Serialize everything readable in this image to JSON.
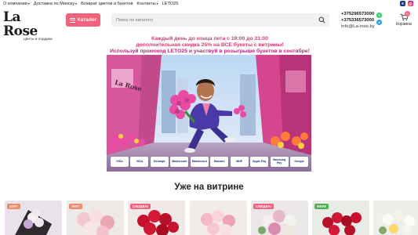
{
  "topnav": {
    "items": [
      {
        "label": "О компании",
        "dropdown": true
      },
      {
        "label": "Доставка по Минску",
        "dropdown": true
      },
      {
        "label": "Возврат цветов и букетов",
        "dropdown": false
      },
      {
        "label": "Контакты",
        "dropdown": true
      },
      {
        "label": "LETO25",
        "dropdown": false
      }
    ],
    "social": [
      "vk-icon",
      "instagram-icon"
    ]
  },
  "header": {
    "logo_text": "La Rose",
    "logo_subtitle": "цветы и подарки",
    "catalog_label": "Каталог",
    "search_placeholder": "Поиск по каталогу",
    "phone1": "+375296573000",
    "phone2": "+375336573000",
    "email": "info@La-rose.by",
    "cart_label": "Корзина",
    "cart_count": "0"
  },
  "promo": {
    "line1": "Каждый день до конца лета с 19:00 до 21:00",
    "line2": "дополнительная скидка 25% на ВСЕ букеты с витрины!",
    "line3": "Используй промокод LETO25 и участвуй в розыгрыше букетов в сентябре!"
  },
  "banner": {
    "storefront_sign": "La Rose",
    "payments": [
      "VISA",
      "VISA",
      "Белкарт",
      "Mastercard",
      "Mastercard",
      "Maestro",
      "МИР",
      "Apple Pay",
      "Samsung Pay",
      "Google"
    ]
  },
  "section": {
    "title": "Уже на витрине"
  },
  "products": [
    {
      "badge": "ХИТ!",
      "badge_type": "hit"
    },
    {
      "badge": "ХИТ!",
      "badge_type": "hit"
    },
    {
      "badge": "СКИДКА!",
      "badge_type": "sale"
    },
    {
      "badge": "",
      "badge_type": ""
    },
    {
      "badge": "СКИДКА!",
      "badge_type": "sale"
    },
    {
      "badge": "NEW!",
      "badge_type": "new"
    },
    {
      "badge": "",
      "badge_type": ""
    }
  ],
  "colors": {
    "accent": "#f2627c",
    "promo_text": "#e5346b"
  }
}
